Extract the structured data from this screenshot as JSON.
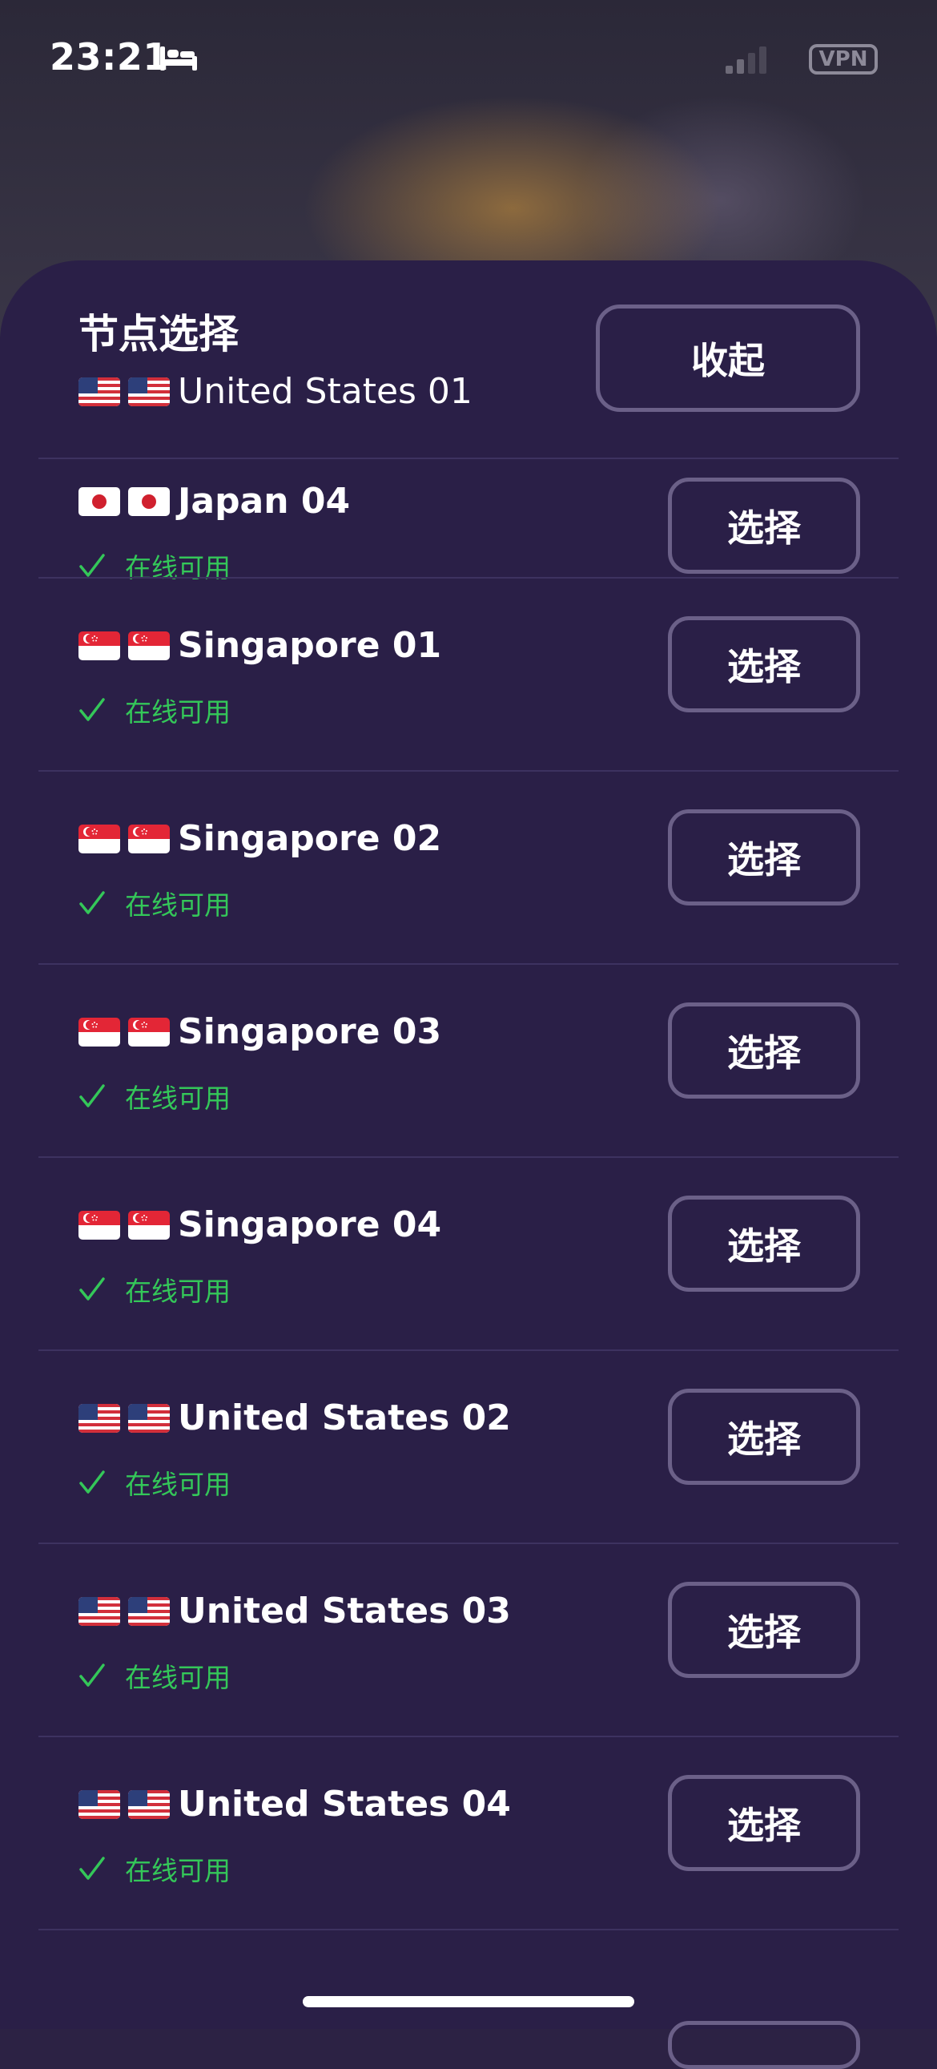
{
  "status_bar": {
    "time": "23:21",
    "sleep_icon": "bed-icon",
    "signal_icon": "cellular-signal-icon",
    "vpn_badge": "VPN"
  },
  "sheet": {
    "title": "节点选择",
    "current_node": {
      "name": "United States 01",
      "flag": "us"
    },
    "collapse_label": "收起"
  },
  "nodes": [
    {
      "name": "Japan 04",
      "flag": "jp",
      "status": "在线可用",
      "button": "选择"
    },
    {
      "name": "Singapore 01",
      "flag": "sg",
      "status": "在线可用",
      "button": "选择"
    },
    {
      "name": "Singapore 02",
      "flag": "sg",
      "status": "在线可用",
      "button": "选择"
    },
    {
      "name": "Singapore 03",
      "flag": "sg",
      "status": "在线可用",
      "button": "选择"
    },
    {
      "name": "Singapore 04",
      "flag": "sg",
      "status": "在线可用",
      "button": "选择"
    },
    {
      "name": "United States 02",
      "flag": "us",
      "status": "在线可用",
      "button": "选择"
    },
    {
      "name": "United States 03",
      "flag": "us",
      "status": "在线可用",
      "button": "选择"
    },
    {
      "name": "United States 04",
      "flag": "us",
      "status": "在线可用",
      "button": "选择"
    }
  ],
  "colors": {
    "sheet_bg": "#2a1f47",
    "button_border": "#6b6088",
    "status_green": "#34c759"
  }
}
